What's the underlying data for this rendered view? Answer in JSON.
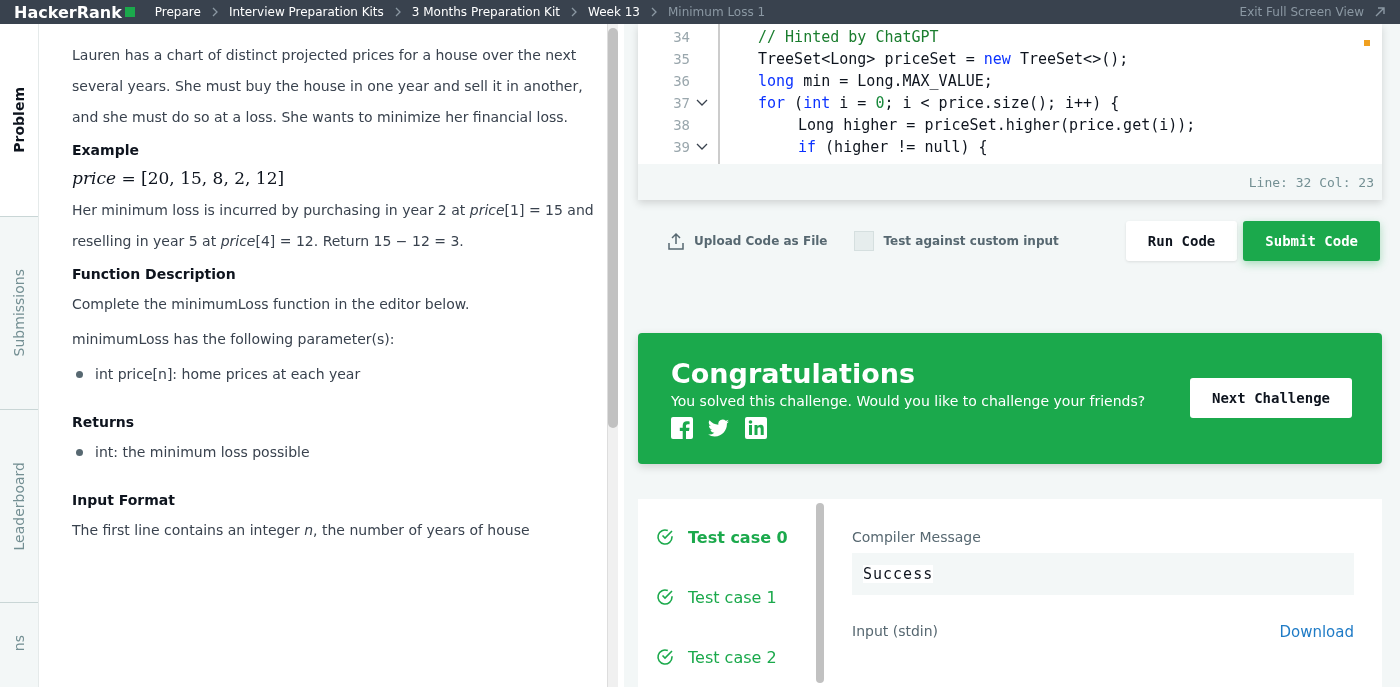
{
  "top_bar": {
    "logo": "HackerRank",
    "breadcrumbs": [
      "Prepare",
      "Interview Preparation Kits",
      "3 Months Preparation Kit",
      "Week 13",
      "Minimum Loss 1"
    ],
    "exit_link": "Exit Full Screen View"
  },
  "side_tabs": [
    {
      "label": "Problem",
      "selected": true
    },
    {
      "label": "Submissions",
      "selected": false
    },
    {
      "label": "Leaderboard",
      "selected": false
    },
    {
      "label": "ns",
      "selected": false
    }
  ],
  "problem": [
    {
      "kind": "para",
      "text": "Lauren has a chart of distinct projected prices for a house over the next several years. She must buy the house in one year and sell it in another, and she must do so at a loss. She wants to minimize her financial loss."
    },
    {
      "kind": "heading",
      "text": "Example"
    },
    {
      "kind": "math",
      "text": "*price* = [20, 15, 8, 2, 12]"
    },
    {
      "kind": "para",
      "text": "Her minimum loss is incurred by purchasing in year 2 at *price*[1] = 15 and reselling in year 5 at *price*[4] = 12. Return 15 − 12 = 3."
    },
    {
      "kind": "heading",
      "text": "Function Description"
    },
    {
      "kind": "para",
      "text": "Complete the minimumLoss function in the editor below."
    },
    {
      "kind": "para",
      "text": "minimumLoss has the following parameter(s):"
    },
    {
      "kind": "bullet",
      "text": "int price[n]: home prices at each year"
    },
    {
      "kind": "heading",
      "text": "Returns"
    },
    {
      "kind": "bullet",
      "text": "int: the minimum loss possible"
    },
    {
      "kind": "heading",
      "text": "Input Format"
    },
    {
      "kind": "para",
      "text": "The first line contains an integer *n*, the number of years of house"
    }
  ],
  "editor": {
    "lines": [
      {
        "num": "34",
        "fold": false,
        "indented": false,
        "tokens": [
          {
            "kind": "comment",
            "t": "// Hinted by ChatGPT"
          }
        ]
      },
      {
        "num": "35",
        "fold": false,
        "indented": false,
        "tokens": [
          {
            "kind": "plain",
            "t": "TreeSet<Long> priceSet = "
          },
          {
            "kind": "keyword",
            "t": "new"
          },
          {
            "kind": "plain",
            "t": " TreeSet<>();"
          }
        ]
      },
      {
        "num": "36",
        "fold": false,
        "indented": false,
        "tokens": [
          {
            "kind": "keyword",
            "t": "long"
          },
          {
            "kind": "plain",
            "t": " min = Long.MAX_VALUE;"
          }
        ]
      },
      {
        "num": "37",
        "fold": true,
        "indented": false,
        "tokens": [
          {
            "kind": "keyword",
            "t": "for"
          },
          {
            "kind": "plain",
            "t": " ("
          },
          {
            "kind": "keyword",
            "t": "int"
          },
          {
            "kind": "plain",
            "t": " i = "
          },
          {
            "kind": "number",
            "t": "0"
          },
          {
            "kind": "plain",
            "t": "; i < price.size(); i++) {"
          }
        ]
      },
      {
        "num": "38",
        "fold": false,
        "indented": true,
        "tokens": [
          {
            "kind": "plain",
            "t": "Long higher = priceSet.higher(price.get(i));"
          }
        ]
      },
      {
        "num": "39",
        "fold": true,
        "indented": true,
        "tokens": [
          {
            "kind": "keyword",
            "t": "if"
          },
          {
            "kind": "plain",
            "t": " (higher != null) {"
          }
        ]
      }
    ],
    "status": "Line: 32 Col: 23"
  },
  "actions": {
    "upload": "Upload Code as File",
    "custom_input": {
      "label": "Test against custom input",
      "checked": false
    },
    "run": "Run Code",
    "submit": "Submit Code"
  },
  "congrats": {
    "title": "Congratulations",
    "message": "You solved this challenge. Would you like to challenge your friends?",
    "button": "Next Challenge"
  },
  "results": {
    "test_cases": [
      {
        "label": "Test case 0",
        "selected": true
      },
      {
        "label": "Test case 1",
        "selected": false
      },
      {
        "label": "Test case 2",
        "selected": false
      }
    ],
    "compiler_label": "Compiler Message",
    "compiler_message": "Success",
    "input_label": "Input (stdin)",
    "download": "Download"
  }
}
